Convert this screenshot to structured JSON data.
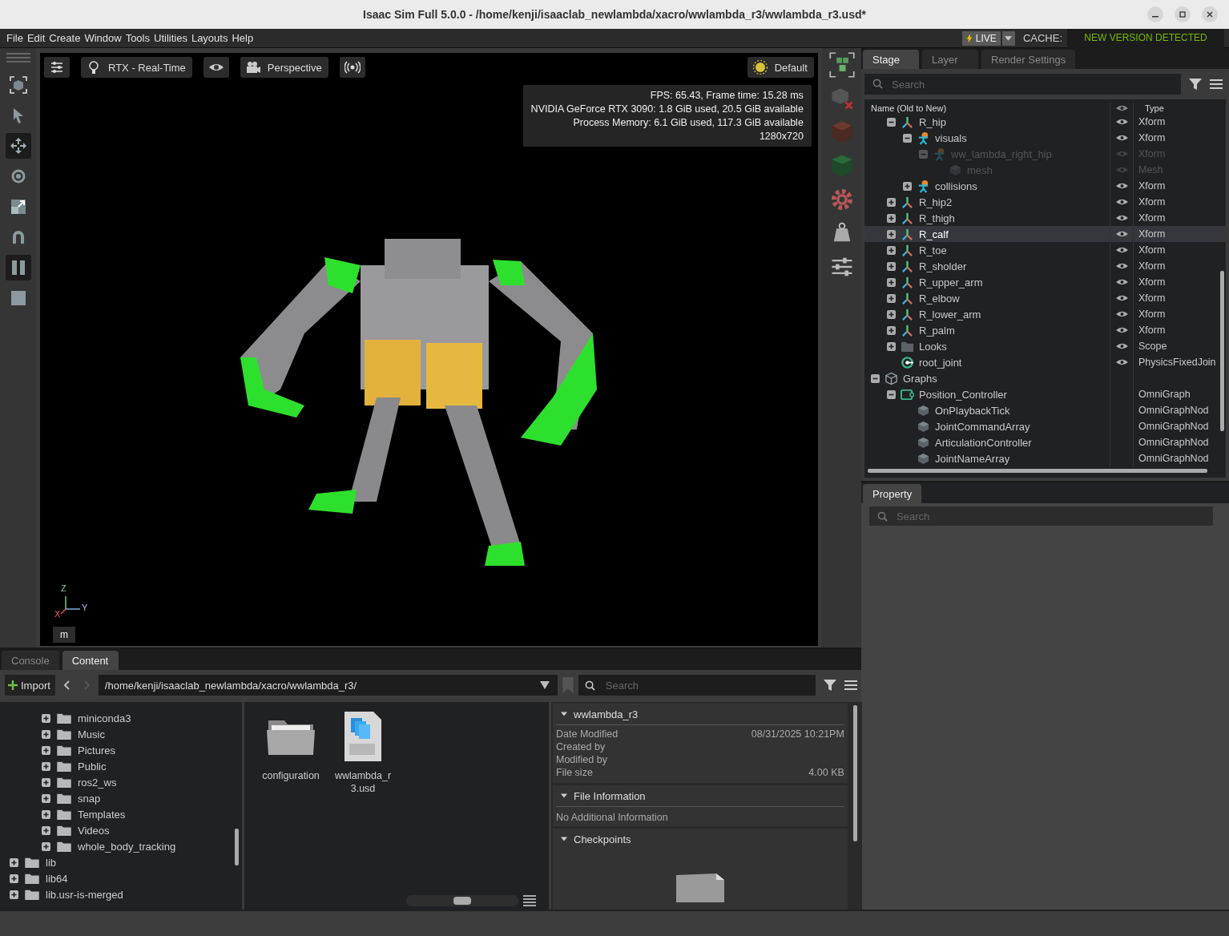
{
  "window": {
    "title": "Isaac Sim Full 5.0.0 - /home/kenji/isaaclab_newlambda/xacro/wwlambda_r3/wwlambda_r3.usd*"
  },
  "menu": [
    "File",
    "Edit",
    "Create",
    "Window",
    "Tools",
    "Utilities",
    "Layouts",
    "Help"
  ],
  "live": {
    "label": "LIVE"
  },
  "cache": {
    "label": "CACHE:",
    "status": "NEW VERSION DETECTED"
  },
  "tools": [
    {
      "kind": "frame",
      "selected": false
    },
    {
      "kind": "select",
      "selected": false
    },
    {
      "kind": "move",
      "selected": true
    },
    {
      "kind": "rotate",
      "selected": false
    },
    {
      "kind": "scale",
      "selected": false
    },
    {
      "kind": "snap",
      "selected": false
    },
    {
      "kind": "pause",
      "selected": true
    },
    {
      "kind": "stop",
      "selected": false
    }
  ],
  "viewport": {
    "toolbar": [
      {
        "kind": "settings"
      },
      {
        "kind": "bulb",
        "label": "RTX - Real-Time"
      },
      {
        "kind": "eye"
      },
      {
        "kind": "camera",
        "label": "Perspective"
      },
      {
        "kind": "broadcast"
      }
    ],
    "lighting": {
      "label": "Default"
    },
    "stats": [
      "FPS: 65.43, Frame time: 15.28 ms",
      "NVIDIA GeForce RTX 3090: 1.8 GiB used, 20.5 GiB available",
      "Process Memory: 6.1 GiB used, 117.3 GiB available",
      "1280x720"
    ],
    "axes": {
      "z": "Z",
      "y": "Y",
      "x": "X"
    },
    "units": "m"
  },
  "stage": {
    "tabs": [
      {
        "label": "Stage",
        "selected": true
      },
      {
        "label": "Layer",
        "selected": false
      },
      {
        "label": "Render Settings",
        "selected": false
      }
    ],
    "search": {
      "placeholder": "Search"
    },
    "columns": {
      "name": "Name (Old to New)",
      "type": "Type"
    },
    "tree": [
      {
        "children": [
          {
            "name": "R_hip",
            "kind": "xform",
            "type": "Xform",
            "visible": true,
            "expanded": true,
            "selected": false,
            "children": [
              {
                "name": "visuals",
                "kind": "rig",
                "type": "Xform",
                "visible": true,
                "expanded": true,
                "selected": false,
                "children": [
                  {
                    "name": "ww_lambda_right_hip",
                    "kind": "rig",
                    "type": "Xform",
                    "visible": false,
                    "expanded": true,
                    "selected": false,
                    "children": [
                      {
                        "name": "mesh",
                        "kind": "mesh",
                        "type": "Mesh",
                        "visible": false,
                        "selected": false
                      }
                    ]
                  }
                ]
              },
              {
                "name": "collisions",
                "kind": "rig",
                "type": "Xform",
                "visible": true,
                "expanded": false,
                "selected": false
              }
            ]
          },
          {
            "name": "R_hip2",
            "kind": "xform",
            "type": "Xform",
            "visible": true,
            "expanded": false,
            "selected": false
          },
          {
            "name": "R_thigh",
            "kind": "xform",
            "type": "Xform",
            "visible": true,
            "expanded": false,
            "selected": false
          },
          {
            "name": "R_calf",
            "kind": "xform",
            "type": "Xform",
            "visible": true,
            "expanded": false,
            "selected": true
          },
          {
            "name": "R_toe",
            "kind": "xform",
            "type": "Xform",
            "visible": true,
            "expanded": false,
            "selected": false
          },
          {
            "name": "R_sholder",
            "kind": "xform",
            "type": "Xform",
            "visible": true,
            "expanded": false,
            "selected": false
          },
          {
            "name": "R_upper_arm",
            "kind": "xform",
            "type": "Xform",
            "visible": true,
            "expanded": false,
            "selected": false
          },
          {
            "name": "R_elbow",
            "kind": "xform",
            "type": "Xform",
            "visible": true,
            "expanded": false,
            "selected": false
          },
          {
            "name": "R_lower_arm",
            "kind": "xform",
            "type": "Xform",
            "visible": true,
            "expanded": false,
            "selected": false
          },
          {
            "name": "R_palm",
            "kind": "xform",
            "type": "Xform",
            "visible": true,
            "expanded": false,
            "selected": false
          },
          {
            "name": "Looks",
            "kind": "folder",
            "type": "Scope",
            "visible": true,
            "expanded": false,
            "selected": false
          },
          {
            "name": "root_joint",
            "kind": "joint",
            "type": "PhysicsFixedJoin",
            "visible": true,
            "selected": false
          }
        ]
      },
      {
        "name": "Graphs",
        "kind": "scope",
        "expanded": true,
        "selected": false,
        "children": [
          {
            "name": "Position_Controller",
            "kind": "graph",
            "type": "OmniGraph",
            "expanded": true,
            "selected": false,
            "children": [
              {
                "name": "OnPlaybackTick",
                "kind": "node",
                "type": "OmniGraphNod",
                "selected": false
              },
              {
                "name": "JointCommandArray",
                "kind": "node",
                "type": "OmniGraphNod",
                "selected": false
              },
              {
                "name": "ArticulationController",
                "kind": "node",
                "type": "OmniGraphNod",
                "selected": false
              },
              {
                "name": "JointNameArray",
                "kind": "node",
                "type": "OmniGraphNod",
                "selected": false
              }
            ]
          }
        ]
      }
    ]
  },
  "property": {
    "tab": {
      "label": "Property",
      "selected": true
    },
    "search": {
      "placeholder": "Search"
    }
  },
  "content": {
    "tabs": [
      {
        "label": "Console",
        "selected": false
      },
      {
        "label": "Content",
        "selected": true
      }
    ],
    "import": "Import",
    "path": "/home/kenji/isaaclab_newlambda/xacro/wwlambda_r3/",
    "search": {
      "placeholder": "Search"
    },
    "tree": [
      {
        "children": [
          {
            "children": [
              {
                "name": "miniconda3",
                "expanded": false
              },
              {
                "name": "Music",
                "expanded": false
              },
              {
                "name": "Pictures",
                "expanded": false
              },
              {
                "name": "Public",
                "expanded": false
              },
              {
                "name": "ros2_ws",
                "expanded": false
              },
              {
                "name": "snap",
                "expanded": false
              },
              {
                "name": "Templates",
                "expanded": false
              },
              {
                "name": "Videos",
                "expanded": false
              },
              {
                "name": "whole_body_tracking",
                "expanded": false
              }
            ]
          },
          {
            "name": "lib",
            "expanded": false
          },
          {
            "name": "lib64",
            "expanded": false
          },
          {
            "name": "lib.usr-is-merged",
            "expanded": false
          }
        ]
      }
    ],
    "items": [
      {
        "name": "configuration",
        "kind": "folder"
      },
      {
        "name": "wwlambda_r3.usd",
        "kind": "usd"
      }
    ],
    "details": [
      {
        "kind": "properties",
        "title": "wwlambda_r3",
        "expanded": true,
        "rows": [
          {
            "label": "Date Modified",
            "value": "08/31/2025 10:21PM"
          },
          {
            "label": "Created by"
          },
          {
            "label": "Modified by"
          },
          {
            "label": "File size",
            "value": "4.00 KB"
          }
        ]
      },
      {
        "kind": "note",
        "title": "File Information",
        "expanded": true,
        "note": "No Additional Information"
      },
      {
        "kind": "checkpoints",
        "title": "Checkpoints",
        "expanded": true
      }
    ]
  }
}
